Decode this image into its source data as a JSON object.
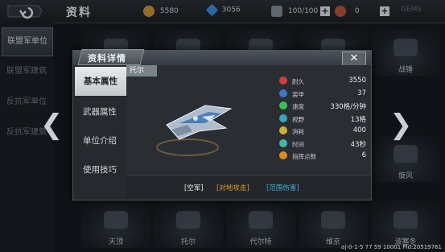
{
  "topbar": {
    "title": "资料",
    "gold": "5580",
    "crystal": "3056",
    "supply": "100/100",
    "fuel": "0",
    "gems": "GEMS"
  },
  "sidebar": {
    "items": [
      {
        "label": "联盟军单位"
      },
      {
        "label": "联盟军建筑"
      },
      {
        "label": "反抗军单位"
      },
      {
        "label": "反抗军建筑"
      }
    ]
  },
  "units": {
    "bottom_labels": [
      "天顶",
      "托尔",
      "代尔特",
      "维京",
      "波塞冬"
    ],
    "right_labels": [
      "战锤",
      "旋风"
    ]
  },
  "modal": {
    "title": "资料详情",
    "close": "✕",
    "tabs": [
      {
        "label": "基本属性"
      },
      {
        "label": "武器属性"
      },
      {
        "label": "单位介绍"
      },
      {
        "label": "使用技巧"
      }
    ],
    "unit_name": "托尔",
    "stats": [
      {
        "icon": "heart-icon",
        "color": "#d23c3c",
        "name": "耐久",
        "value": "3550"
      },
      {
        "icon": "armor-icon",
        "color": "#3f78c8",
        "name": "装甲",
        "value": "37"
      },
      {
        "icon": "speed-icon",
        "color": "#3cbf5a",
        "name": "速度",
        "value": "330格/分钟"
      },
      {
        "icon": "eye-icon",
        "color": "#3aa6b8",
        "name": "视野",
        "value": "13格"
      },
      {
        "icon": "cost-icon",
        "color": "#c9b332",
        "name": "消耗",
        "value": "400"
      },
      {
        "icon": "clock-icon",
        "color": "#44b6a8",
        "name": "时间",
        "value": "43秒"
      },
      {
        "icon": "star-icon",
        "color": "#e08a26",
        "name": "指挥点数",
        "value": "6"
      }
    ],
    "tags": [
      {
        "label": "[空军]",
        "color": "#e9ecef"
      },
      {
        "label": "[对地攻击]",
        "color": "#e39b2c"
      },
      {
        "label": "[范围伤害]",
        "color": "#3fb2e0"
      }
    ]
  },
  "footer": {
    "version": "a|-0-1-5 77 59 10001 Pld:20519761"
  }
}
